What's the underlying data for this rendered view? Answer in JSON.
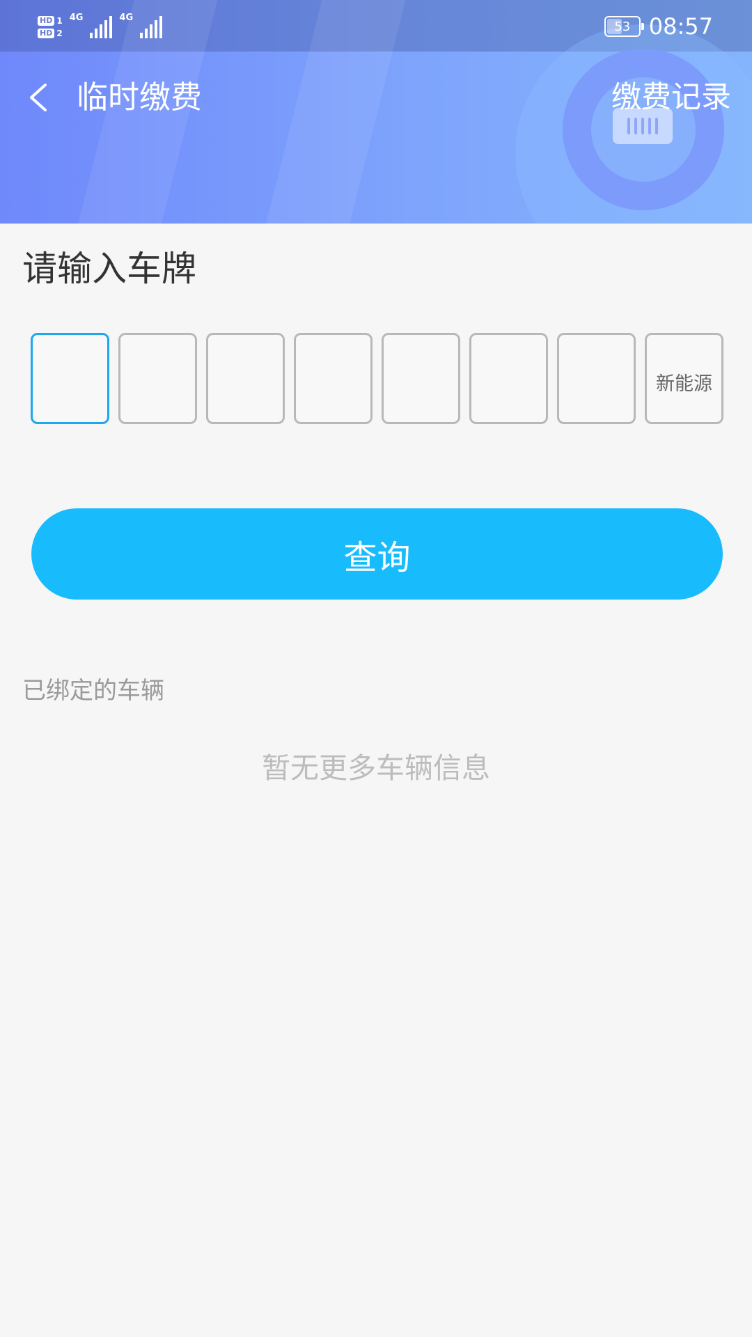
{
  "status_bar": {
    "sim1_badge": "HD",
    "sim1_slot": "1",
    "sim2_badge": "HD",
    "sim2_slot": "2",
    "network1": "4G",
    "network2": "4G",
    "battery_percent": "53",
    "battery_level": 0.53,
    "time": "08:57"
  },
  "app_bar": {
    "title": "临时缴费",
    "records_label": "缴费记录"
  },
  "plate_input": {
    "heading": "请输入车牌",
    "cells": [
      "",
      "",
      "",
      "",
      "",
      "",
      "",
      "新能源"
    ],
    "active_index": 0
  },
  "query_button": {
    "label": "查询"
  },
  "bound_vehicles": {
    "heading": "已绑定的车辆",
    "empty_message": "暂无更多车辆信息"
  },
  "colors": {
    "accent": "#18bcfd",
    "active_border": "#1ba8ec",
    "header_start": "#6f88fb",
    "header_end": "#84b4fc"
  }
}
